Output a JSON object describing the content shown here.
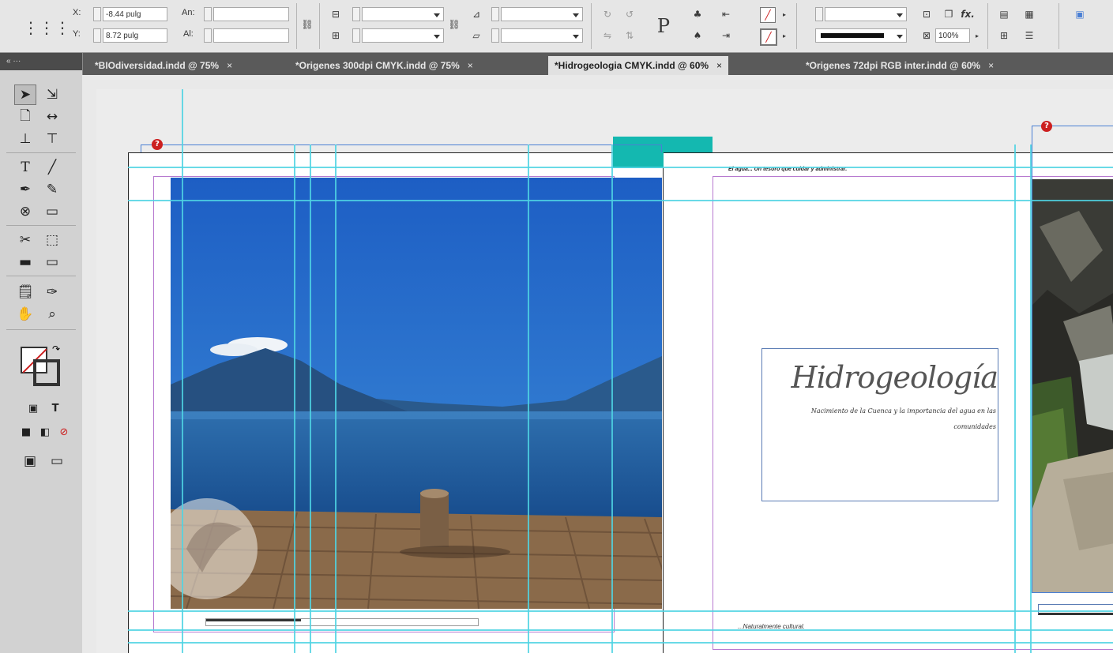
{
  "control_bar": {
    "x_label": "X:",
    "x_value": "-8.44 pulg",
    "y_label": "Y:",
    "y_value": "8.72 pulg",
    "w_label": "An:",
    "h_label": "Al:",
    "zoom_value": "100%",
    "fx_label": "fx."
  },
  "tabs": [
    {
      "label": "*BIOdiversidad.indd @ 75%",
      "close": "×"
    },
    {
      "label": "*Origenes 300dpi CMYK.indd @ 75%",
      "close": "×"
    },
    {
      "label": "*Hidrogeologia CMYK.indd @ 60%",
      "close": "×",
      "active": true
    },
    {
      "label": "*Origenes 72dpi RGB inter.indd @ 60%",
      "close": "×"
    }
  ],
  "document": {
    "running_header": "El agua... Un tesoro que cuidar y administrar.",
    "title": "Hidrogeología",
    "subtitle_line1": "Nacimiento de la Cuenca y la importancia del agua en las",
    "subtitle_line2": "comunidades",
    "footer": "...Naturalmente cultural."
  },
  "colors": {
    "guide": "#4fd3e3",
    "margin": "#b77ad0",
    "teal_block": "#14b8b0",
    "title": "#555555",
    "warning": "#cc1f1f"
  },
  "icons": {
    "warning": "warning-icon",
    "selection": "selection-tool-icon",
    "type": "type-tool-icon"
  }
}
